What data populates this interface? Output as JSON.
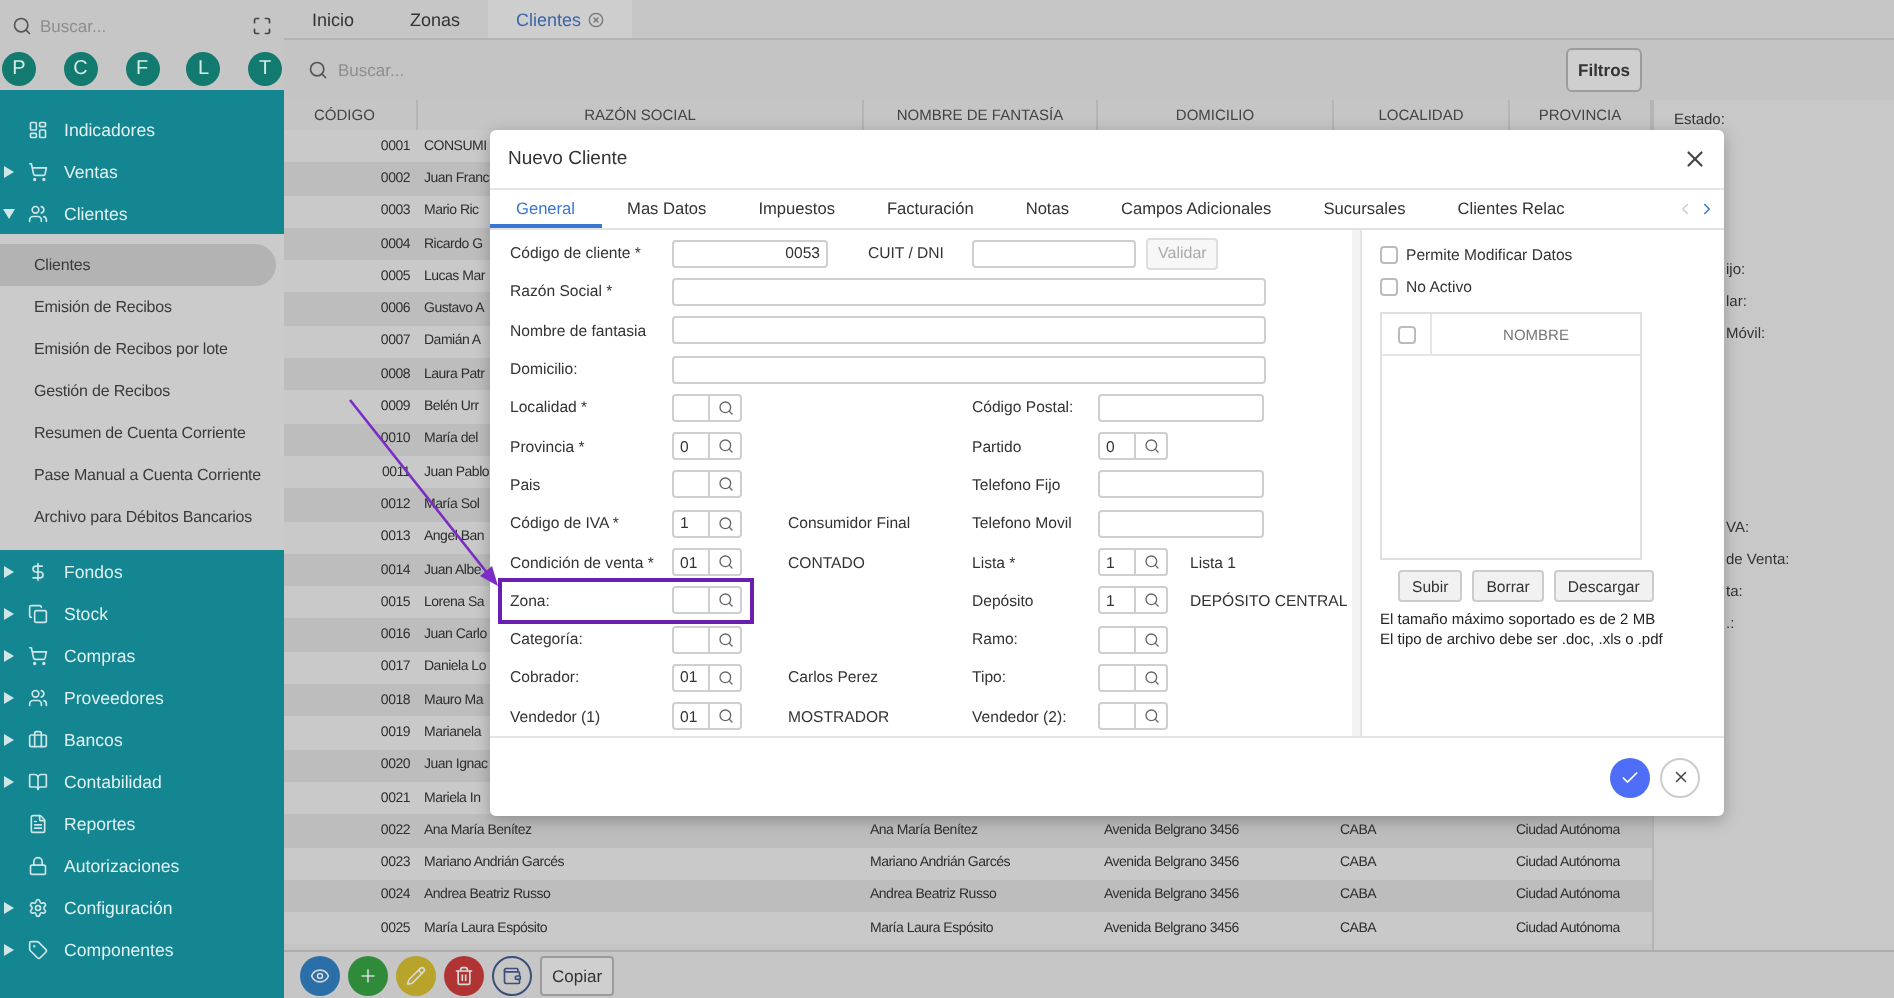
{
  "sidebar": {
    "search": {
      "placeholder": "Buscar..."
    },
    "shortcuts": [
      "P",
      "C",
      "F",
      "L",
      "T"
    ],
    "menu": [
      {
        "label": "Indicadores",
        "kind": "link"
      },
      {
        "label": "Ventas",
        "kind": "group",
        "expanded": false
      },
      {
        "label": "Clientes",
        "kind": "group",
        "expanded": true,
        "children": [
          {
            "label": "Clientes",
            "selected": true
          },
          {
            "label": "Emisión de Recibos",
            "selected": false
          },
          {
            "label": "Emisión de Recibos por lote",
            "selected": false
          },
          {
            "label": "Gestión de Recibos",
            "selected": false
          },
          {
            "label": "Resumen de Cuenta Corriente",
            "selected": false
          },
          {
            "label": "Pase Manual a Cuenta Corriente",
            "selected": false
          },
          {
            "label": "Archivo para Débitos Bancarios",
            "selected": false
          }
        ]
      },
      {
        "label": "Fondos",
        "kind": "group",
        "expanded": false
      },
      {
        "label": "Stock",
        "kind": "group",
        "expanded": false
      },
      {
        "label": "Compras",
        "kind": "group",
        "expanded": false
      },
      {
        "label": "Proveedores",
        "kind": "group",
        "expanded": false
      },
      {
        "label": "Bancos",
        "kind": "group",
        "expanded": false
      },
      {
        "label": "Contabilidad",
        "kind": "group",
        "expanded": false
      },
      {
        "label": "Reportes",
        "kind": "link"
      },
      {
        "label": "Autorizaciones",
        "kind": "link"
      },
      {
        "label": "Configuración",
        "kind": "group",
        "expanded": false
      },
      {
        "label": "Componentes",
        "kind": "group",
        "expanded": false
      }
    ]
  },
  "tabs": [
    {
      "label": "Inicio",
      "selected": false,
      "closable": false
    },
    {
      "label": "Zonas",
      "selected": false,
      "closable": false
    },
    {
      "label": "Clientes",
      "selected": true,
      "closable": true
    }
  ],
  "search": {
    "placeholder": "Buscar..."
  },
  "filters_button": "Filtros",
  "table": {
    "columns": [
      "CÓDIGO",
      "RAZÓN SOCIAL",
      "NOMBRE DE FANTASÍA",
      "DOMICILIO",
      "LOCALIDAD",
      "PROVINCIA"
    ],
    "rows": [
      [
        "0001",
        "CONSUMI"
      ],
      [
        "0002",
        "Juan Franc"
      ],
      [
        "0003",
        "Mario Ric"
      ],
      [
        "0004",
        "Ricardo G"
      ],
      [
        "0005",
        "Lucas Mar"
      ],
      [
        "0006",
        "Gustavo A"
      ],
      [
        "0007",
        "Damián A"
      ],
      [
        "0008",
        "Laura Patr"
      ],
      [
        "0009",
        "Belén Urr"
      ],
      [
        "0010",
        "María del"
      ],
      [
        "0011",
        "Juan Pablo"
      ],
      [
        "0012",
        "María Sol"
      ],
      [
        "0013",
        "Angel Ban"
      ],
      [
        "0014",
        "Juan Albe"
      ],
      [
        "0015",
        "Lorena Sa"
      ],
      [
        "0016",
        "Juan Carlo"
      ],
      [
        "0017",
        "Daniela Lo"
      ],
      [
        "0018",
        "Mauro Ma"
      ],
      [
        "0019",
        "Marianela"
      ],
      [
        "0020",
        "Juan Ignac"
      ],
      [
        "0021",
        "Mariela In"
      ],
      [
        "0022",
        "Ana María Benítez",
        "Ana María Benítez",
        "Avenida Belgrano 3456",
        "CABA",
        "Ciudad Autónoma"
      ],
      [
        "0023",
        "Mariano Andrián Garcés",
        "Mariano Andrián Garcés",
        "Avenida Belgrano 3456",
        "CABA",
        "Ciudad Autónoma"
      ],
      [
        "0024",
        "Andrea Beatriz Russo",
        "Andrea Beatriz Russo",
        "Avenida Belgrano 3456",
        "CABA",
        "Ciudad Autónoma"
      ],
      [
        "0025",
        "María Laura Espósito",
        "María Laura Espósito",
        "Avenida Belgrano 3456",
        "CABA",
        "Ciudad Autónoma"
      ]
    ]
  },
  "side_panel": {
    "title": "Estado:",
    "labels_top": [
      "ijo:",
      "lar:",
      "Móvil:"
    ],
    "labels_bottom": [
      "VA:",
      "de Venta:",
      "ta:",
      ".:"
    ]
  },
  "toolbar": {
    "icon_buttons": [
      {
        "kind": "view"
      },
      {
        "kind": "add"
      },
      {
        "kind": "edit"
      },
      {
        "kind": "delete"
      },
      {
        "kind": "wallet"
      }
    ],
    "copy_button": "Copiar"
  },
  "modal": {
    "title": "Nuevo Cliente",
    "tabs": [
      {
        "label": "General",
        "selected": true
      },
      {
        "label": "Mas Datos",
        "selected": false
      },
      {
        "label": "Impuestos",
        "selected": false
      },
      {
        "label": "Facturación",
        "selected": false
      },
      {
        "label": "Notas",
        "selected": false
      },
      {
        "label": "Campos Adicionales",
        "selected": false
      },
      {
        "label": "Sucursales",
        "selected": false
      },
      {
        "label": "Clientes Relac",
        "selected": false
      }
    ],
    "form": [
      {
        "left": {
          "kind": "code",
          "label": "Código de cliente *",
          "value": "0053"
        },
        "right": {
          "kind": "validated",
          "label": "CUIT / DNI",
          "button": "Validar",
          "button_disabled": true
        }
      },
      {
        "left": {
          "kind": "wide",
          "label": "Razón Social *"
        }
      },
      {
        "left": {
          "kind": "wide",
          "label": "Nombre de fantasia"
        }
      },
      {
        "left": {
          "kind": "wide",
          "label": "Domicilio:"
        }
      },
      {
        "left": {
          "kind": "lookup",
          "label": "Localidad *"
        },
        "right": {
          "kind": "input",
          "label": "Código Postal:"
        }
      },
      {
        "left": {
          "kind": "lookup",
          "label": "Provincia *",
          "value": "0"
        },
        "right": {
          "kind": "lookup",
          "label": "Partido",
          "value": "0"
        }
      },
      {
        "left": {
          "kind": "lookup",
          "label": "Pais"
        },
        "right": {
          "kind": "input",
          "label": "Telefono Fijo"
        }
      },
      {
        "left": {
          "kind": "lookup",
          "label": "Código de IVA *",
          "value": "1",
          "note": "Consumidor Final"
        },
        "right": {
          "kind": "input",
          "label": "Telefono Movil"
        }
      },
      {
        "left": {
          "kind": "lookup",
          "label": "Condición de venta *",
          "value": "01",
          "note": "CONTADO"
        },
        "right": {
          "kind": "lookup",
          "label": "Lista *",
          "value": "1",
          "note": "Lista 1"
        }
      },
      {
        "left": {
          "kind": "lookup",
          "label": "Zona:"
        },
        "right": {
          "kind": "lookup",
          "label": "Depósito",
          "value": "1",
          "note": "DEPÓSITO CENTRAL"
        }
      },
      {
        "left": {
          "kind": "lookup",
          "label": "Categoría:"
        },
        "right": {
          "kind": "lookup",
          "label": "Ramo:"
        }
      },
      {
        "left": {
          "kind": "lookup",
          "label": "Cobrador:",
          "value": "01",
          "note": "Carlos Perez"
        },
        "right": {
          "kind": "lookup",
          "label": "Tipo:"
        }
      },
      {
        "left": {
          "kind": "lookup",
          "label": "Vendedor (1)",
          "value": "01",
          "note": "MOSTRADOR"
        },
        "right": {
          "kind": "lookup",
          "label": "Vendedor (2):"
        }
      }
    ],
    "options": [
      {
        "label": "Permite Modificar Datos",
        "checked": false
      },
      {
        "label": "No Activo",
        "checked": false
      }
    ],
    "files": {
      "header": "NOMBRE",
      "all_checked": false
    },
    "file_buttons": [
      "Subir",
      "Borrar",
      "Descargar"
    ],
    "notes": [
      "El tamaño máximo soportado es de 2 MB",
      "El tipo de archivo debe ser .doc, .xls o .pdf"
    ]
  }
}
